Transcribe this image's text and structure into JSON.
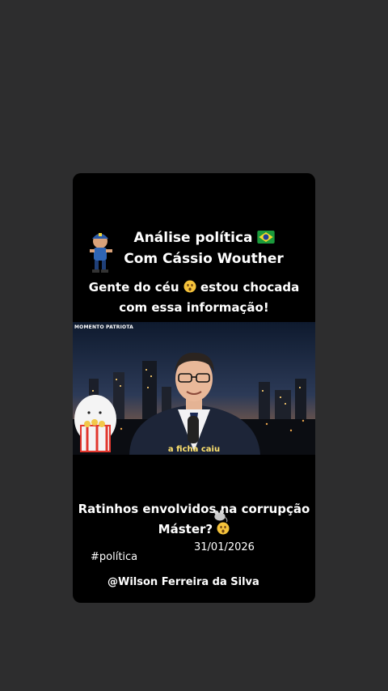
{
  "header": {
    "title_line1": "Análise política",
    "title_line2": "Com Cássio Wouther",
    "subtitle_line1": "Gente do céu",
    "subtitle_line1_end": "estou chocada",
    "subtitle_line2": "com essa informação!"
  },
  "video": {
    "logo": "MOMENTO PATRIOTA",
    "caption": "a ficha caiu"
  },
  "footer": {
    "text_line1": "Ratinhos envolvidos na corrupção",
    "text_line2": "Máster?",
    "date": "31/01/2026",
    "hashtag": "#política",
    "handle": "@Wilson Ferreira da Silva"
  },
  "icons": {
    "flag": "brazil-flag-icon",
    "surprised": "astonished-face-icon",
    "mascot": "bolsonaro-mascot-icon",
    "popcorn": "popcorn-character-icon",
    "mouse": "mouse-icon"
  },
  "colors": {
    "background": "#2d2d2e",
    "card": "#000000",
    "caption": "#ffe36e"
  }
}
